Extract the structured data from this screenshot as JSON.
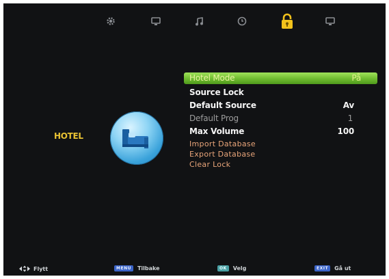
{
  "top_tabs": [
    {
      "id": "settings",
      "icon": "gear-icon",
      "active": false
    },
    {
      "id": "picture",
      "icon": "monitor-icon",
      "active": false
    },
    {
      "id": "sound",
      "icon": "music-note-icon",
      "active": false
    },
    {
      "id": "time",
      "icon": "clock-icon",
      "active": false
    },
    {
      "id": "lock",
      "icon": "padlock-icon",
      "active": true
    },
    {
      "id": "setup",
      "icon": "monitor-icon",
      "active": false
    }
  ],
  "page": {
    "title": "HOTEL"
  },
  "menu": {
    "hotel_mode": {
      "label": "Hotel Mode",
      "value": "På"
    },
    "source_lock": {
      "label": "Source Lock"
    },
    "default_source": {
      "label": "Default Source",
      "value": "Av"
    },
    "default_prog": {
      "label": "Default Prog",
      "value": "1"
    },
    "max_volume": {
      "label": "Max Volume",
      "value": "100"
    },
    "import_database": {
      "label": "Import Database"
    },
    "export_database": {
      "label": "Export Database"
    },
    "clear_lock": {
      "label": "Clear Lock"
    }
  },
  "bottom_bar": {
    "move": {
      "label": "Flytt"
    },
    "back": {
      "key": "MENU",
      "label": "Tilbake"
    },
    "select": {
      "key": "OK",
      "label": "Velg"
    },
    "exit": {
      "key": "EXIT",
      "label": "Gå ut"
    }
  },
  "colors": {
    "accent": "#f2c21c",
    "selection": "#7cc43a",
    "screen_bg": "#111214"
  }
}
